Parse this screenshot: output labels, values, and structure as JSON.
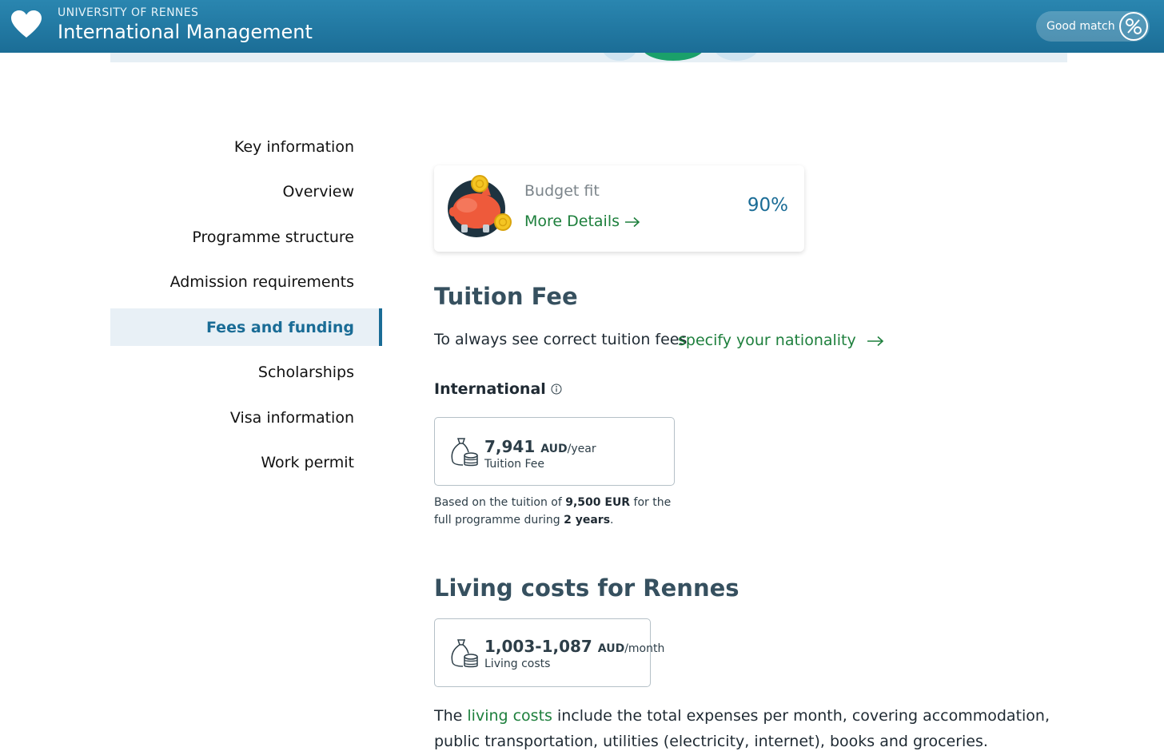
{
  "header": {
    "university": "UNIVERSITY OF RENNES",
    "programme": "International Management",
    "match_label": "Good match",
    "colors": {
      "bar": "#1b6d96",
      "accent_green": "#1d7f3c"
    }
  },
  "sidebar": {
    "items": [
      {
        "label": "Key information"
      },
      {
        "label": "Overview"
      },
      {
        "label": "Programme structure"
      },
      {
        "label": "Admission requirements"
      },
      {
        "label": "Fees and funding",
        "active": true
      },
      {
        "label": "Scholarships"
      },
      {
        "label": "Visa information"
      },
      {
        "label": "Work permit"
      }
    ]
  },
  "budget": {
    "label": "Budget fit",
    "link": "More Details",
    "value": "90%"
  },
  "tuition": {
    "heading": "Tuition Fee",
    "nationality_text": "To always see correct tuition fees",
    "nationality_link": "specify your nationality",
    "group_label": "International",
    "amount": "7,941",
    "currency": "AUD",
    "period": "/year",
    "sublabel": "Tuition Fee",
    "note_prefix": "Based on the tuition of",
    "note_amount": "9,500 EUR",
    "note_middle": "for the full programme during",
    "note_duration": "2 years",
    "note_suffix": "."
  },
  "living": {
    "heading": "Living costs for Rennes",
    "amount": "1,003-1,087",
    "currency": "AUD",
    "period": "/month",
    "sublabel": "Living costs",
    "desc_prefix": "The",
    "desc_link": "living costs",
    "desc_rest": "include the total expenses per month, covering accommodation, public transportation, utilities (electricity, internet), books and groceries."
  }
}
